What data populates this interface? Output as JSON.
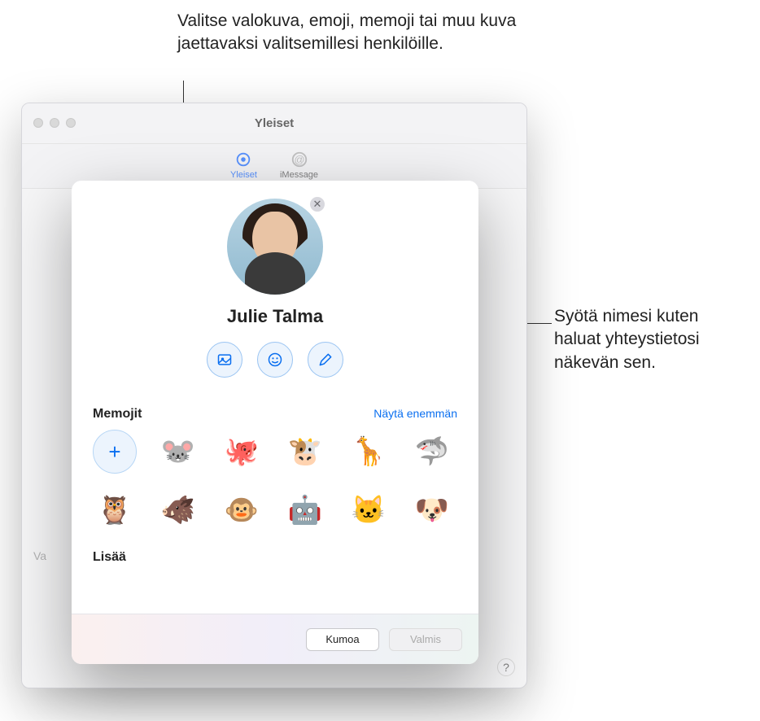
{
  "callouts": {
    "top": "Valitse valokuva, emoji, memoji tai muu kuva jaettavaksi valitsemillesi henkilöille.",
    "right": "Syötä nimesi kuten haluat yhteystietosi näkevän sen."
  },
  "bg_window": {
    "title": "Yleiset",
    "tabs": {
      "general": "Yleiset",
      "imessage": "iMessage"
    },
    "left_label_fragment": "Va",
    "help_glyph": "?"
  },
  "sheet": {
    "avatar_close_glyph": "✕",
    "display_name": "Julie Talma",
    "memoji_section_title": "Memojit",
    "memoji_show_more": "Näytä enemmän",
    "memoji": [
      {
        "name": "add",
        "glyph": "+"
      },
      {
        "name": "mouse",
        "glyph": "🐭"
      },
      {
        "name": "octopus",
        "glyph": "🐙"
      },
      {
        "name": "cow",
        "glyph": "🐮"
      },
      {
        "name": "giraffe",
        "glyph": "🦒"
      },
      {
        "name": "shark",
        "glyph": "🦈"
      },
      {
        "name": "owl",
        "glyph": "🦉"
      },
      {
        "name": "boar",
        "glyph": "🐗"
      },
      {
        "name": "monkey",
        "glyph": "🐵"
      },
      {
        "name": "robot",
        "glyph": "🤖"
      },
      {
        "name": "cat",
        "glyph": "🐱"
      },
      {
        "name": "dog",
        "glyph": "🐶"
      }
    ],
    "more_section_title": "Lisää",
    "footer": {
      "cancel": "Kumoa",
      "done": "Valmis"
    }
  }
}
